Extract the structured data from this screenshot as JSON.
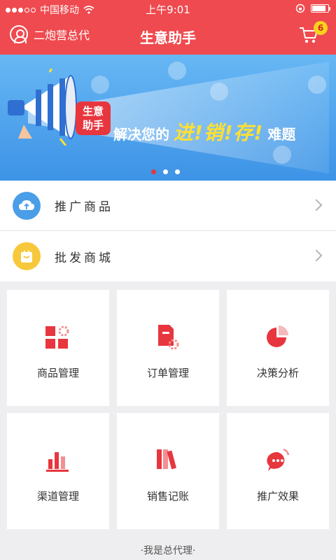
{
  "status_bar": {
    "carrier": "中国移动",
    "time": "上午9:01"
  },
  "header": {
    "user_name": "二炮营总代",
    "title": "生意助手",
    "cart_count": "6"
  },
  "banner": {
    "logo_line1": "生意",
    "logo_line2": "助手",
    "text_prefix": "解决您的",
    "text_emphasis": "进!销!存!",
    "text_suffix": "难题",
    "pages": 3,
    "active_page": 1
  },
  "list": [
    {
      "label": "推广商品",
      "icon": "cloud-upload-icon",
      "color": "#4a9ee8"
    },
    {
      "label": "批发商城",
      "icon": "shopping-bag-icon",
      "color": "#f7c83c"
    }
  ],
  "grid": [
    {
      "label": "商品管理",
      "icon": "product-grid-icon"
    },
    {
      "label": "订单管理",
      "icon": "order-doc-icon"
    },
    {
      "label": "决策分析",
      "icon": "pie-chart-icon"
    },
    {
      "label": "渠道管理",
      "icon": "bar-chart-icon"
    },
    {
      "label": "销售记账",
      "icon": "ledger-books-icon"
    },
    {
      "label": "推广效果",
      "icon": "chat-bubble-icon"
    }
  ],
  "footer": {
    "text": "·我是总代理·"
  },
  "colors": {
    "brand_red": "#ef4a4f",
    "icon_red": "#e8363e",
    "badge_yellow": "#f9d21b"
  }
}
